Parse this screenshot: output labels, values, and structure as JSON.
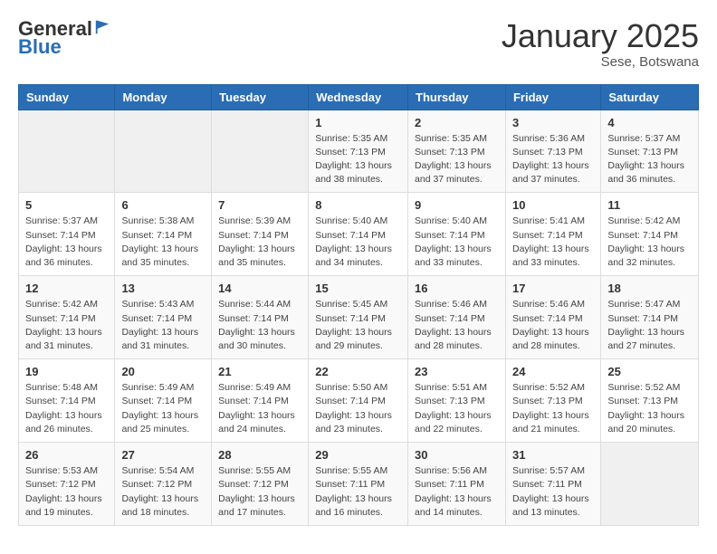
{
  "header": {
    "logo_general": "General",
    "logo_blue": "Blue",
    "title": "January 2025",
    "subtitle": "Sese, Botswana"
  },
  "weekdays": [
    "Sunday",
    "Monday",
    "Tuesday",
    "Wednesday",
    "Thursday",
    "Friday",
    "Saturday"
  ],
  "weeks": [
    [
      {
        "day": "",
        "sunrise": "",
        "sunset": "",
        "daylight": ""
      },
      {
        "day": "",
        "sunrise": "",
        "sunset": "",
        "daylight": ""
      },
      {
        "day": "",
        "sunrise": "",
        "sunset": "",
        "daylight": ""
      },
      {
        "day": "1",
        "sunrise": "Sunrise: 5:35 AM",
        "sunset": "Sunset: 7:13 PM",
        "daylight": "Daylight: 13 hours and 38 minutes."
      },
      {
        "day": "2",
        "sunrise": "Sunrise: 5:35 AM",
        "sunset": "Sunset: 7:13 PM",
        "daylight": "Daylight: 13 hours and 37 minutes."
      },
      {
        "day": "3",
        "sunrise": "Sunrise: 5:36 AM",
        "sunset": "Sunset: 7:13 PM",
        "daylight": "Daylight: 13 hours and 37 minutes."
      },
      {
        "day": "4",
        "sunrise": "Sunrise: 5:37 AM",
        "sunset": "Sunset: 7:13 PM",
        "daylight": "Daylight: 13 hours and 36 minutes."
      }
    ],
    [
      {
        "day": "5",
        "sunrise": "Sunrise: 5:37 AM",
        "sunset": "Sunset: 7:14 PM",
        "daylight": "Daylight: 13 hours and 36 minutes."
      },
      {
        "day": "6",
        "sunrise": "Sunrise: 5:38 AM",
        "sunset": "Sunset: 7:14 PM",
        "daylight": "Daylight: 13 hours and 35 minutes."
      },
      {
        "day": "7",
        "sunrise": "Sunrise: 5:39 AM",
        "sunset": "Sunset: 7:14 PM",
        "daylight": "Daylight: 13 hours and 35 minutes."
      },
      {
        "day": "8",
        "sunrise": "Sunrise: 5:40 AM",
        "sunset": "Sunset: 7:14 PM",
        "daylight": "Daylight: 13 hours and 34 minutes."
      },
      {
        "day": "9",
        "sunrise": "Sunrise: 5:40 AM",
        "sunset": "Sunset: 7:14 PM",
        "daylight": "Daylight: 13 hours and 33 minutes."
      },
      {
        "day": "10",
        "sunrise": "Sunrise: 5:41 AM",
        "sunset": "Sunset: 7:14 PM",
        "daylight": "Daylight: 13 hours and 33 minutes."
      },
      {
        "day": "11",
        "sunrise": "Sunrise: 5:42 AM",
        "sunset": "Sunset: 7:14 PM",
        "daylight": "Daylight: 13 hours and 32 minutes."
      }
    ],
    [
      {
        "day": "12",
        "sunrise": "Sunrise: 5:42 AM",
        "sunset": "Sunset: 7:14 PM",
        "daylight": "Daylight: 13 hours and 31 minutes."
      },
      {
        "day": "13",
        "sunrise": "Sunrise: 5:43 AM",
        "sunset": "Sunset: 7:14 PM",
        "daylight": "Daylight: 13 hours and 31 minutes."
      },
      {
        "day": "14",
        "sunrise": "Sunrise: 5:44 AM",
        "sunset": "Sunset: 7:14 PM",
        "daylight": "Daylight: 13 hours and 30 minutes."
      },
      {
        "day": "15",
        "sunrise": "Sunrise: 5:45 AM",
        "sunset": "Sunset: 7:14 PM",
        "daylight": "Daylight: 13 hours and 29 minutes."
      },
      {
        "day": "16",
        "sunrise": "Sunrise: 5:46 AM",
        "sunset": "Sunset: 7:14 PM",
        "daylight": "Daylight: 13 hours and 28 minutes."
      },
      {
        "day": "17",
        "sunrise": "Sunrise: 5:46 AM",
        "sunset": "Sunset: 7:14 PM",
        "daylight": "Daylight: 13 hours and 28 minutes."
      },
      {
        "day": "18",
        "sunrise": "Sunrise: 5:47 AM",
        "sunset": "Sunset: 7:14 PM",
        "daylight": "Daylight: 13 hours and 27 minutes."
      }
    ],
    [
      {
        "day": "19",
        "sunrise": "Sunrise: 5:48 AM",
        "sunset": "Sunset: 7:14 PM",
        "daylight": "Daylight: 13 hours and 26 minutes."
      },
      {
        "day": "20",
        "sunrise": "Sunrise: 5:49 AM",
        "sunset": "Sunset: 7:14 PM",
        "daylight": "Daylight: 13 hours and 25 minutes."
      },
      {
        "day": "21",
        "sunrise": "Sunrise: 5:49 AM",
        "sunset": "Sunset: 7:14 PM",
        "daylight": "Daylight: 13 hours and 24 minutes."
      },
      {
        "day": "22",
        "sunrise": "Sunrise: 5:50 AM",
        "sunset": "Sunset: 7:14 PM",
        "daylight": "Daylight: 13 hours and 23 minutes."
      },
      {
        "day": "23",
        "sunrise": "Sunrise: 5:51 AM",
        "sunset": "Sunset: 7:13 PM",
        "daylight": "Daylight: 13 hours and 22 minutes."
      },
      {
        "day": "24",
        "sunrise": "Sunrise: 5:52 AM",
        "sunset": "Sunset: 7:13 PM",
        "daylight": "Daylight: 13 hours and 21 minutes."
      },
      {
        "day": "25",
        "sunrise": "Sunrise: 5:52 AM",
        "sunset": "Sunset: 7:13 PM",
        "daylight": "Daylight: 13 hours and 20 minutes."
      }
    ],
    [
      {
        "day": "26",
        "sunrise": "Sunrise: 5:53 AM",
        "sunset": "Sunset: 7:12 PM",
        "daylight": "Daylight: 13 hours and 19 minutes."
      },
      {
        "day": "27",
        "sunrise": "Sunrise: 5:54 AM",
        "sunset": "Sunset: 7:12 PM",
        "daylight": "Daylight: 13 hours and 18 minutes."
      },
      {
        "day": "28",
        "sunrise": "Sunrise: 5:55 AM",
        "sunset": "Sunset: 7:12 PM",
        "daylight": "Daylight: 13 hours and 17 minutes."
      },
      {
        "day": "29",
        "sunrise": "Sunrise: 5:55 AM",
        "sunset": "Sunset: 7:11 PM",
        "daylight": "Daylight: 13 hours and 16 minutes."
      },
      {
        "day": "30",
        "sunrise": "Sunrise: 5:56 AM",
        "sunset": "Sunset: 7:11 PM",
        "daylight": "Daylight: 13 hours and 14 minutes."
      },
      {
        "day": "31",
        "sunrise": "Sunrise: 5:57 AM",
        "sunset": "Sunset: 7:11 PM",
        "daylight": "Daylight: 13 hours and 13 minutes."
      },
      {
        "day": "",
        "sunrise": "",
        "sunset": "",
        "daylight": ""
      }
    ]
  ]
}
